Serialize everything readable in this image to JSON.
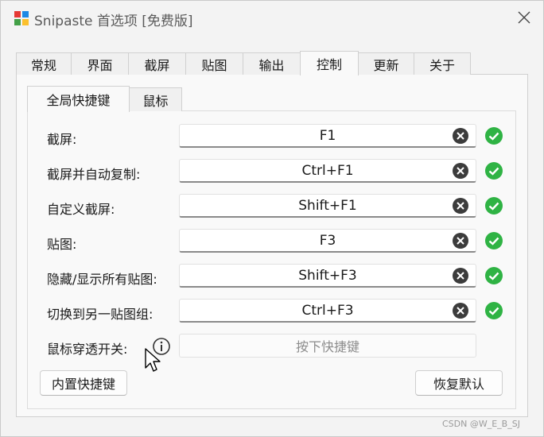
{
  "window": {
    "title": "Snipaste 首选项 [免费版]"
  },
  "tabs": [
    {
      "label": "常规"
    },
    {
      "label": "界面"
    },
    {
      "label": "截屏"
    },
    {
      "label": "贴图"
    },
    {
      "label": "输出"
    },
    {
      "label": "控制",
      "active": true
    },
    {
      "label": "更新"
    },
    {
      "label": "关于"
    }
  ],
  "subtabs": [
    {
      "label": "全局快捷键",
      "active": true
    },
    {
      "label": "鼠标"
    }
  ],
  "hotkeys": [
    {
      "label": "截屏:",
      "value": "F1",
      "status": "valid"
    },
    {
      "label": "截屏并自动复制:",
      "value": "Ctrl+F1",
      "status": "valid"
    },
    {
      "label": "自定义截屏:",
      "value": "Shift+F1",
      "status": "valid"
    },
    {
      "label": "贴图:",
      "value": "F3",
      "status": "valid"
    },
    {
      "label": "隐藏/显示所有贴图:",
      "value": "Shift+F3",
      "status": "valid"
    },
    {
      "label": "切换到另一贴图组:",
      "value": "Ctrl+F3",
      "status": "valid"
    },
    {
      "label": "鼠标穿透开关:",
      "value": "",
      "placeholder": "按下快捷键"
    }
  ],
  "buttons": {
    "builtin": "内置快捷键",
    "restore": "恢复默认"
  },
  "colors": {
    "valid": "#2fb344",
    "clear": "#3c3c3c"
  },
  "watermark": "CSDN @W_E_B_SJ"
}
